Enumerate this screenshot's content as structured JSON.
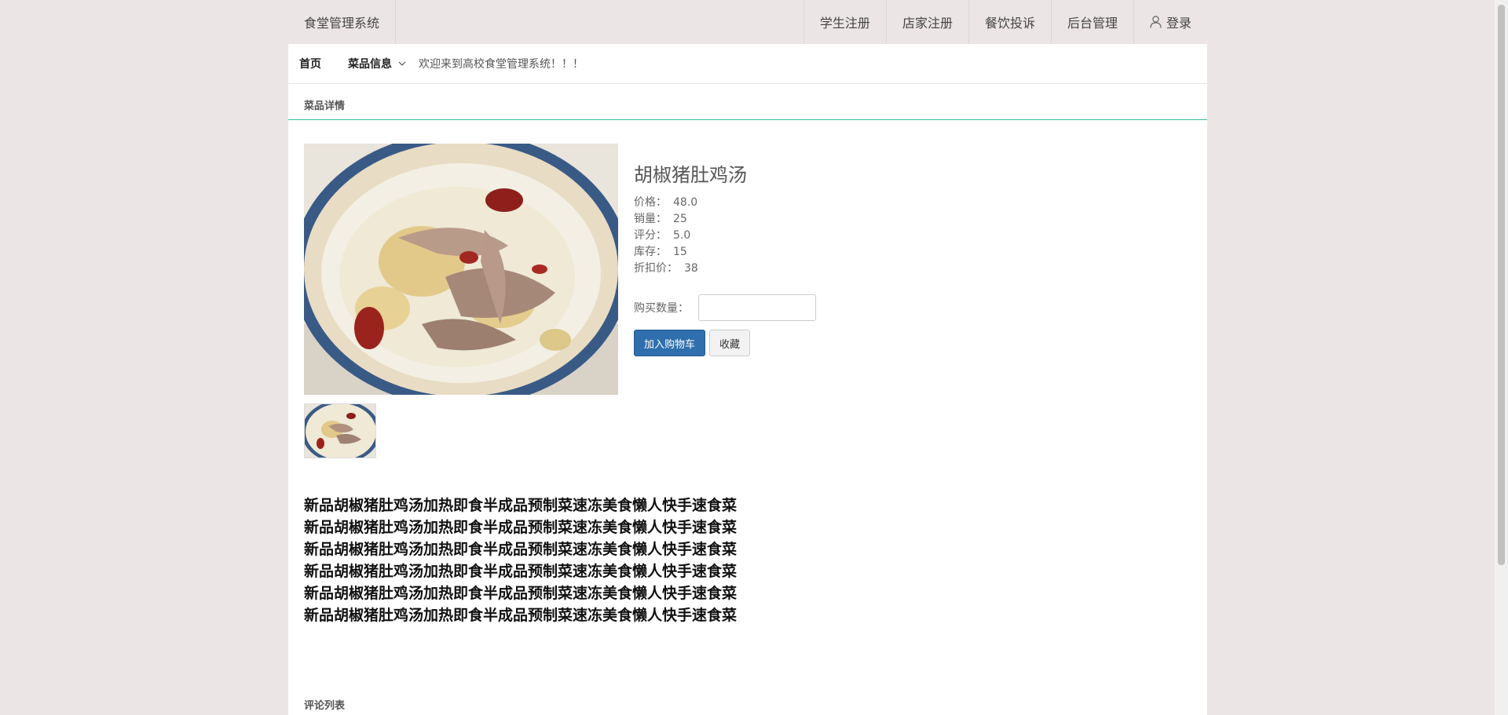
{
  "topbar": {
    "brand": "食堂管理系统",
    "nav": [
      "学生注册",
      "店家注册",
      "餐饮投诉",
      "后台管理"
    ],
    "login": "登录"
  },
  "subnav": {
    "home": "首页",
    "dish_info": "菜品信息",
    "welcome": "欢迎来到高校食堂管理系统！！！"
  },
  "detail": {
    "section_title": "菜品详情",
    "dish_name": "胡椒猪肚鸡汤",
    "fields": [
      {
        "label": "价格：",
        "value": "48.0"
      },
      {
        "label": "销量：",
        "value": "25"
      },
      {
        "label": "评分：",
        "value": "5.0"
      },
      {
        "label": "库存：",
        "value": "15"
      },
      {
        "label": "折扣价：",
        "value": "38"
      }
    ],
    "qty_label": "购买数量：",
    "qty_value": "",
    "add_cart": "加入购物车",
    "favorite": "收藏",
    "description": [
      "新品胡椒猪肚鸡汤加热即食半成品预制菜速冻美食懒人快手速食菜",
      "新品胡椒猪肚鸡汤加热即食半成品预制菜速冻美食懒人快手速食菜",
      "新品胡椒猪肚鸡汤加热即食半成品预制菜速冻美食懒人快手速食菜",
      "新品胡椒猪肚鸡汤加热即食半成品预制菜速冻美食懒人快手速食菜",
      "新品胡椒猪肚鸡汤加热即食半成品预制菜速冻美食懒人快手速食菜",
      "新品胡椒猪肚鸡汤加热即食半成品预制菜速冻美食懒人快手速食菜"
    ]
  },
  "comments": {
    "section_title": "评论列表"
  },
  "colors": {
    "page_bg": "#ebe5e5",
    "accent_line": "#3bbf9b",
    "primary_button": "#2f6fad"
  }
}
